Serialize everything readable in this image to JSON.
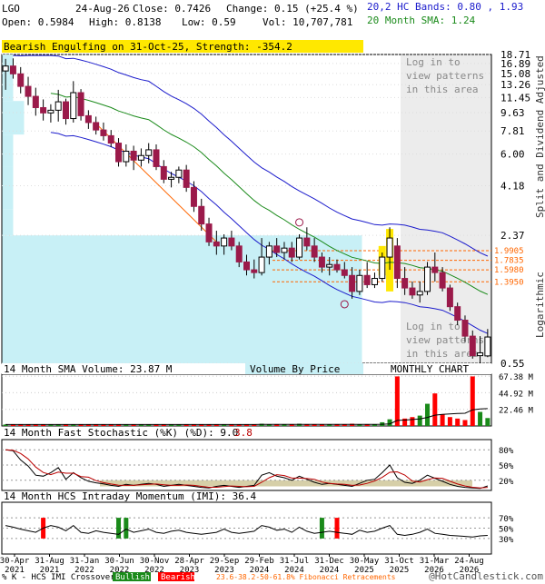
{
  "header": {
    "symbol": "LGO",
    "date": "24-Aug-26",
    "close": "Close: 0.7426",
    "change": "Change: 0.15 (+25.4 %)",
    "open": "Open: 0.5984",
    "high": "High: 0.8138",
    "low": "Low: 0.59",
    "vol": "Vol: 10,707,781",
    "hc_bands": "20,2 HC Bands: 0.80 , 1.93",
    "sma20": "20 Month SMA: 1.24"
  },
  "colors": {
    "up_candle": "#ffffff",
    "down_candle": "#9b1a4a",
    "upper_band": "#1c1ccc",
    "sma": "#1a8a1a",
    "vbp": "#c8f0f6",
    "signal": "#ffe800",
    "fib": "#ff6600",
    "volume_up": "#1a8a1a",
    "volume_down": "#ff0000"
  },
  "price_panel": {
    "pattern_banner": "Bearish Engulfing on 31-Oct-25, Strength: -354.2",
    "login_text_top": [
      "Log in to",
      "view patterns",
      "in this area"
    ],
    "login_text_bottom": [
      "Log in to",
      "view patterns",
      "in this area"
    ],
    "axis_right_label_top": "Split and Dividend Adjusted",
    "axis_right_label_bottom": "Logarithmic",
    "y_ticks": [
      "18.71",
      "16.89",
      "15.08",
      "13.26",
      "11.45",
      "9.63",
      "7.81",
      "6.00",
      "4.18",
      "2.37",
      "0.55"
    ],
    "fib_levels": [
      "1.9905",
      "1.7835",
      "1.5980",
      "1.3950"
    ]
  },
  "volume_panel": {
    "label": "14 Month SMA Volume: 23.87 M",
    "vbp_label": "Volume By Price",
    "chart_label": "MONTHLY CHART",
    "y_ticks": [
      "67.38 M",
      "44.92 M",
      "22.46 M"
    ]
  },
  "stoch_panel": {
    "label": "14 Month Fast Stochastic (%K) (%D): 9.0",
    "d_value": "3.8",
    "y_ticks": [
      "80%",
      "50%",
      "20%"
    ]
  },
  "imi_panel": {
    "label": "14 Month HCS Intraday Momentum (IMI): 36.4",
    "y_ticks": [
      "70%",
      "50%",
      "30%"
    ]
  },
  "x_axis": {
    "labels": [
      "30-Apr\n2021",
      "31-Aug\n2021",
      "31-Jan\n2022",
      "30-Jun\n2022",
      "30-Nov\n2022",
      "28-Apr\n2023",
      "29-Sep\n2023",
      "29-Feb\n2024",
      "31-Jul\n2024",
      "31-Dec\n2024",
      "30-May\n2025",
      "31-Oct\n2025",
      "31-Mar\n2026",
      "24-Aug\n2026"
    ]
  },
  "footer": {
    "legend_prefix": "% K - HCS IMI Crossover,",
    "bullish": "Bullish",
    "bearish": "Bearish",
    "fib_note": "23.6-38.2-50-61.8% Fibonacci Retracements",
    "credit": "@HotCandlestick.com"
  },
  "chart_data": {
    "type": "candlestick",
    "months": 65,
    "x_start": "2021-04",
    "x_end": "2026-08",
    "ylim": [
      0.55,
      18.71
    ],
    "y_scale": "log",
    "candles": [
      [
        15.5,
        17.8,
        12.5,
        16.4
      ],
      [
        16.4,
        17.9,
        14.2,
        15.0
      ],
      [
        15.0,
        16.2,
        12.0,
        13.0
      ],
      [
        13.0,
        14.5,
        10.5,
        11.6
      ],
      [
        11.6,
        12.8,
        9.3,
        10.2
      ],
      [
        10.2,
        11.2,
        8.8,
        9.6
      ],
      [
        9.6,
        10.6,
        8.6,
        9.9
      ],
      [
        9.9,
        12.5,
        8.7,
        10.9
      ],
      [
        10.9,
        11.3,
        8.4,
        9.0
      ],
      [
        9.0,
        13.8,
        8.6,
        12.1
      ],
      [
        12.1,
        12.6,
        8.8,
        9.3
      ],
      [
        9.3,
        9.9,
        8.0,
        8.6
      ],
      [
        8.6,
        9.2,
        7.5,
        7.9
      ],
      [
        7.9,
        8.6,
        7.0,
        7.4
      ],
      [
        7.4,
        7.9,
        6.5,
        6.8
      ],
      [
        6.8,
        7.2,
        5.2,
        5.5
      ],
      [
        5.5,
        6.7,
        5.2,
        6.2
      ],
      [
        6.2,
        6.6,
        5.0,
        5.6
      ],
      [
        5.6,
        6.4,
        5.2,
        5.9
      ],
      [
        5.9,
        6.8,
        5.4,
        6.3
      ],
      [
        6.3,
        6.7,
        5.0,
        5.2
      ],
      [
        5.2,
        5.6,
        4.3,
        4.5
      ],
      [
        4.5,
        4.9,
        4.1,
        4.6
      ],
      [
        4.6,
        5.2,
        4.3,
        5.0
      ],
      [
        5.0,
        5.3,
        3.9,
        4.1
      ],
      [
        4.1,
        4.4,
        3.1,
        3.3
      ],
      [
        3.3,
        3.6,
        2.5,
        2.7
      ],
      [
        2.7,
        2.9,
        2.1,
        2.2
      ],
      [
        2.2,
        2.5,
        1.9,
        2.1
      ],
      [
        2.1,
        2.4,
        1.9,
        2.3
      ],
      [
        2.3,
        2.5,
        2.0,
        2.1
      ],
      [
        2.1,
        2.2,
        1.65,
        1.75
      ],
      [
        1.75,
        1.9,
        1.5,
        1.6
      ],
      [
        1.6,
        1.8,
        1.45,
        1.55
      ],
      [
        1.55,
        2.3,
        1.5,
        1.85
      ],
      [
        1.85,
        2.2,
        1.7,
        2.1
      ],
      [
        2.1,
        2.3,
        1.85,
        1.95
      ],
      [
        1.95,
        2.2,
        1.8,
        2.05
      ],
      [
        2.05,
        2.2,
        1.75,
        1.85
      ],
      [
        1.85,
        2.4,
        1.8,
        2.3
      ],
      [
        2.3,
        2.6,
        2.0,
        2.1
      ],
      [
        2.1,
        2.3,
        1.75,
        1.85
      ],
      [
        1.85,
        1.95,
        1.55,
        1.65
      ],
      [
        1.65,
        1.85,
        1.5,
        1.7
      ],
      [
        1.7,
        1.8,
        1.55,
        1.6
      ],
      [
        1.6,
        1.75,
        1.45,
        1.5
      ],
      [
        1.5,
        1.65,
        1.15,
        1.25
      ],
      [
        1.25,
        1.6,
        1.2,
        1.5
      ],
      [
        1.5,
        1.75,
        1.3,
        1.35
      ],
      [
        1.35,
        1.55,
        1.3,
        1.45
      ],
      [
        1.45,
        1.95,
        1.4,
        1.85
      ],
      [
        1.85,
        2.6,
        1.6,
        2.3
      ],
      [
        2.1,
        2.3,
        1.3,
        1.45
      ],
      [
        1.45,
        1.65,
        1.2,
        1.3
      ],
      [
        1.3,
        1.4,
        1.15,
        1.2
      ],
      [
        1.2,
        1.4,
        1.1,
        1.25
      ],
      [
        1.25,
        1.75,
        1.2,
        1.65
      ],
      [
        1.65,
        1.95,
        1.4,
        1.55
      ],
      [
        1.55,
        1.65,
        1.25,
        1.3
      ],
      [
        1.3,
        1.35,
        1.0,
        1.05
      ],
      [
        1.05,
        1.1,
        0.85,
        0.9
      ],
      [
        0.9,
        0.95,
        0.7,
        0.75
      ],
      [
        0.75,
        0.8,
        0.58,
        0.6
      ],
      [
        0.6,
        0.75,
        0.55,
        0.62
      ],
      [
        0.5984,
        0.8138,
        0.59,
        0.7426
      ]
    ],
    "volume_m": [
      2,
      2,
      2,
      2,
      2,
      2,
      2,
      2,
      2,
      2,
      2,
      2,
      2,
      2,
      2,
      2,
      2,
      2,
      2,
      2,
      2,
      2,
      2,
      2,
      2,
      2,
      2,
      2,
      2,
      2,
      2,
      2,
      2,
      2,
      3,
      2,
      2,
      2,
      2,
      3,
      2,
      2,
      2,
      2,
      2,
      2,
      3,
      2,
      2,
      2,
      5,
      9,
      67,
      10,
      12,
      14,
      30,
      44,
      16,
      12,
      10,
      8,
      67,
      19,
      10.7
    ],
    "stoch_k": [
      80,
      78,
      60,
      48,
      30,
      28,
      35,
      45,
      22,
      35,
      25,
      18,
      15,
      13,
      10,
      8,
      12,
      10,
      12,
      14,
      12,
      8,
      10,
      12,
      10,
      8,
      6,
      5,
      8,
      10,
      8,
      6,
      8,
      10,
      30,
      35,
      28,
      25,
      20,
      28,
      22,
      16,
      12,
      14,
      12,
      10,
      8,
      14,
      20,
      22,
      35,
      50,
      25,
      16,
      14,
      20,
      30,
      24,
      18,
      12,
      8,
      6,
      5,
      4,
      9
    ],
    "imi": [
      55,
      52,
      48,
      45,
      42,
      50,
      55,
      52,
      45,
      55,
      42,
      40,
      45,
      42,
      40,
      38,
      48,
      42,
      45,
      48,
      42,
      40,
      44,
      46,
      42,
      40,
      38,
      40,
      42,
      48,
      42,
      40,
      42,
      44,
      55,
      52,
      46,
      48,
      42,
      52,
      44,
      40,
      42,
      44,
      42,
      40,
      38,
      46,
      42,
      44,
      50,
      55,
      38,
      36,
      38,
      42,
      48,
      40,
      38,
      36,
      35,
      34,
      33,
      35,
      36
    ]
  }
}
